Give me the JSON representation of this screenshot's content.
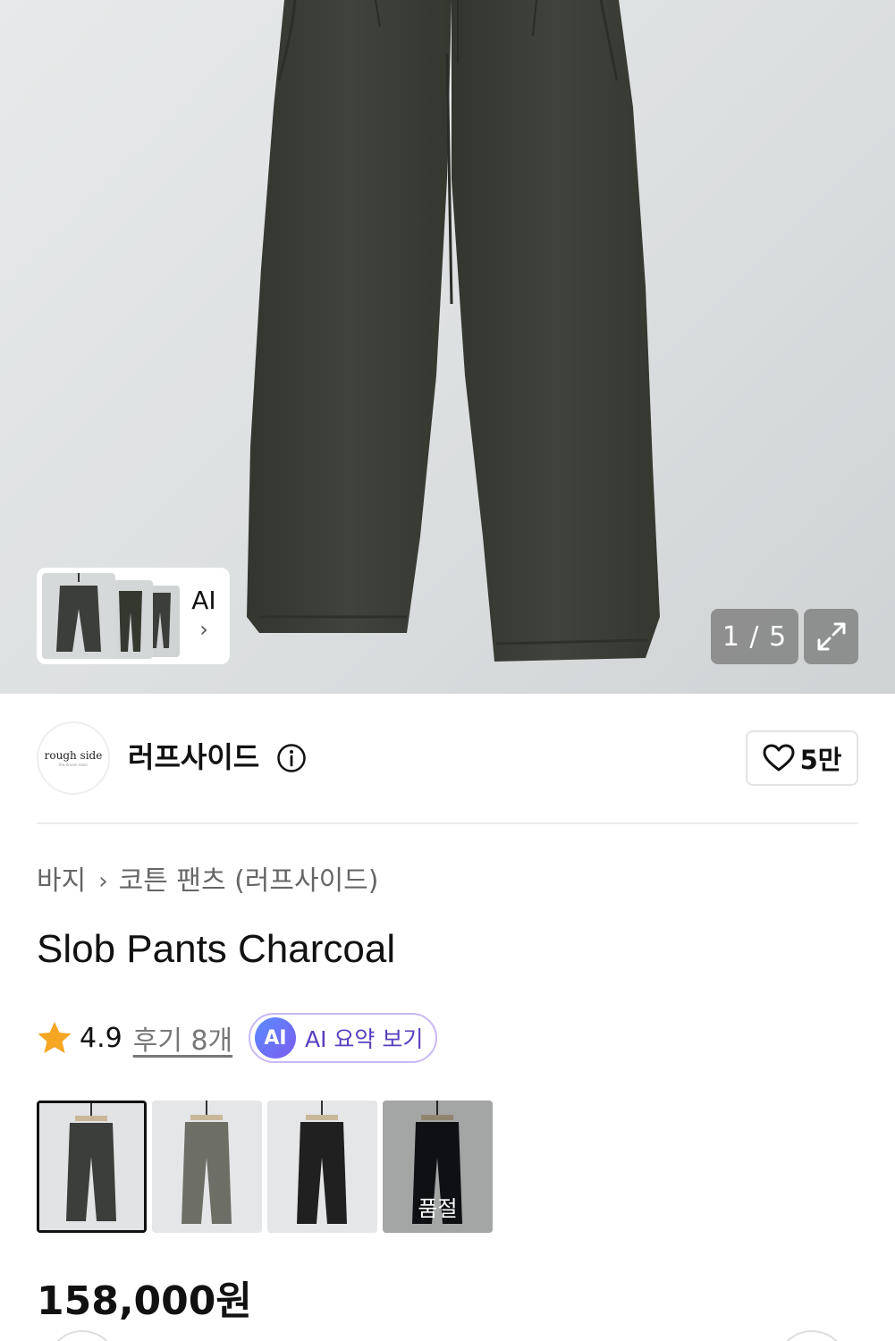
{
  "gallery": {
    "ai_label": "AI",
    "counter": "1 / 5",
    "colors": {
      "pants": "#3b3e3a",
      "background": "#dfe2e3"
    }
  },
  "brand": {
    "logo_text": "rough side",
    "logo_subtext": "the dream tailor",
    "name": "러프사이드",
    "likes": "5만"
  },
  "breadcrumb": {
    "category": "바지",
    "subcategory": "코튼 팬츠 (러프사이드)"
  },
  "product": {
    "title": "Slob Pants Charcoal",
    "rating": "4.9",
    "reviews": "후기 8개",
    "ai_badge": "AI",
    "ai_summary": "AI 요약 보기",
    "price": "158,000원"
  },
  "colors": {
    "star": "#f5a623",
    "ai_border": "#c9b8f5",
    "ai_text": "#5a3fc0"
  },
  "swatches": [
    {
      "color": "#3b3e3a",
      "selected": true,
      "soldout": ""
    },
    {
      "color": "#6d6f66",
      "selected": false,
      "soldout": ""
    },
    {
      "color": "#202020",
      "selected": false,
      "soldout": ""
    },
    {
      "color": "#15171c",
      "selected": false,
      "soldout": "품절"
    }
  ]
}
